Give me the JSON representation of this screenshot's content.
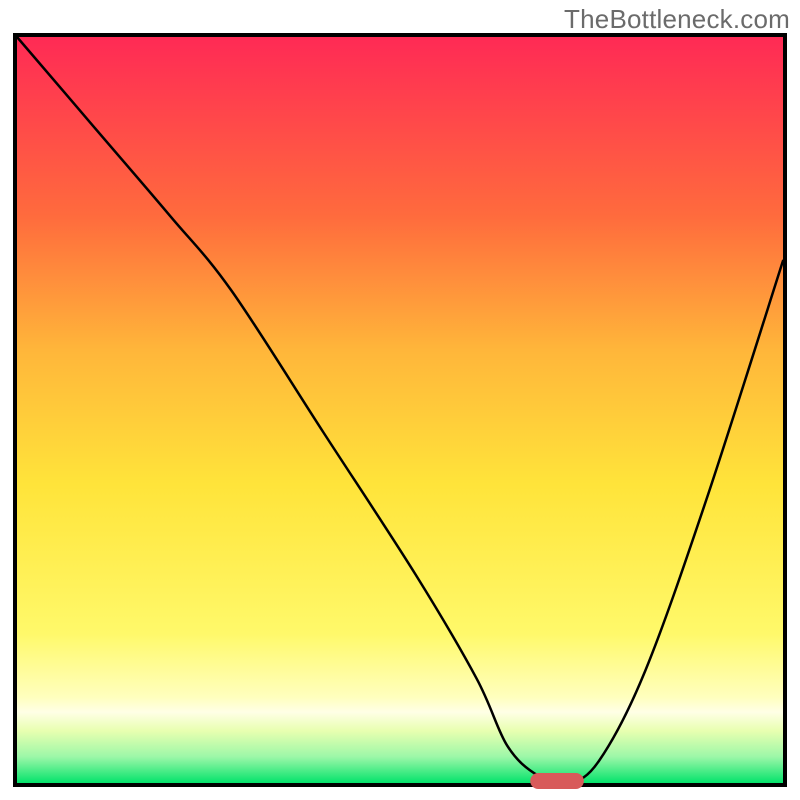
{
  "watermark": "TheBottleneck.com",
  "chart_data": {
    "type": "line",
    "title": "",
    "xlabel": "",
    "ylabel": "",
    "xlim": [
      0,
      100
    ],
    "ylim": [
      0,
      100
    ],
    "background_gradient": {
      "top": "#ff2a55",
      "mid_upper": "#ffb63a",
      "mid": "#ffe43a",
      "mid_lower": "#fff96a",
      "lower": "#e8ffb0",
      "bottom": "#04e36b"
    },
    "series": [
      {
        "name": "bottleneck-curve",
        "x": [
          0,
          10,
          20,
          28,
          40,
          52,
          60,
          64,
          68,
          72,
          76,
          82,
          90,
          100
        ],
        "values": [
          100,
          88,
          76,
          66,
          47,
          28,
          14,
          5,
          1,
          0,
          3,
          15,
          38,
          70
        ]
      }
    ],
    "marker": {
      "name": "optimal-point",
      "x_range": [
        67,
        74
      ],
      "y": 0,
      "color": "#d85a5a"
    },
    "annotations": []
  }
}
